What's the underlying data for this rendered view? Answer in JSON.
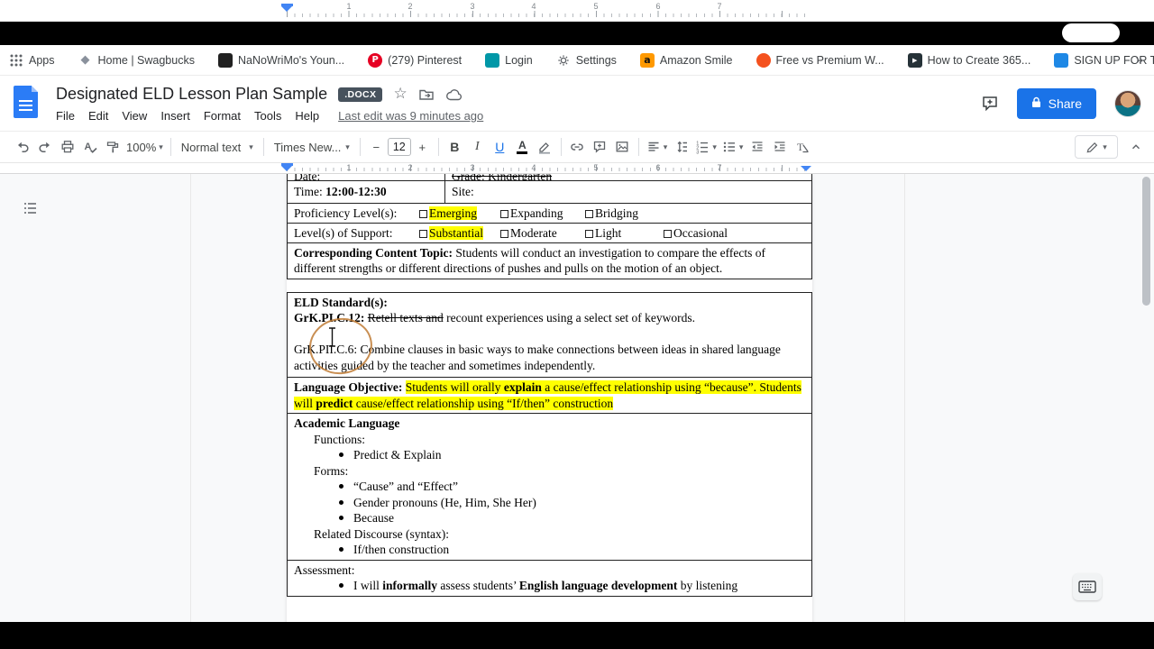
{
  "colors": {
    "accent_blue": "#1a73e8",
    "highlight_yellow": "#ffff00",
    "docx_badge_bg": "#47525d",
    "annotation_orange": "#bf7b35",
    "pinterest_red": "#e60023",
    "amazon_orange": "#ff9900"
  },
  "bookmarks_bar": {
    "apps_label": "Apps",
    "overflow_glyph": "»",
    "items": [
      {
        "label": "Home | Swagbucks",
        "icon": "swagbucks-favicon",
        "glyph": "◆"
      },
      {
        "label": "NaNoWriMo's Youn...",
        "icon": "nanowrimo-favicon",
        "glyph": ""
      },
      {
        "label": "(279) Pinterest",
        "icon": "pinterest-favicon",
        "glyph": "P"
      },
      {
        "label": "Login",
        "icon": "login-favicon",
        "glyph": ""
      },
      {
        "label": "Settings",
        "icon": "settings-gear-favicon",
        "glyph": ""
      },
      {
        "label": "Amazon Smile",
        "icon": "amazon-favicon",
        "glyph": "a"
      },
      {
        "label": "Free vs Premium W...",
        "icon": "generic-favicon",
        "glyph": ""
      },
      {
        "label": "How to Create 365...",
        "icon": "video-favicon",
        "glyph": "▶"
      },
      {
        "label": "SIGN UP FOR THE...",
        "icon": "generic-favicon",
        "glyph": ""
      }
    ]
  },
  "header": {
    "doc_title": "Designated ELD Lesson Plan Sample",
    "file_type_badge": ".DOCX",
    "menu_items": [
      "File",
      "Edit",
      "View",
      "Insert",
      "Format",
      "Tools",
      "Help"
    ],
    "last_edit_status": "Last edit was 9 minutes ago",
    "share_label": "Share"
  },
  "toolbar": {
    "zoom_value": "100%",
    "style_value": "Normal text",
    "font_value": "Times New...",
    "font_size_value": "12",
    "bold_glyph": "B",
    "italic_glyph": "I",
    "underline_glyph": "U",
    "text_color_glyph": "A",
    "minus_glyph": "−",
    "plus_glyph": "+",
    "caret_glyph": "▾"
  },
  "ruler": {
    "numbers": [
      "1",
      "2",
      "3",
      "4",
      "5",
      "6",
      "7"
    ]
  },
  "document": {
    "rowA": {
      "date_label": "Date:",
      "grade_struck": "Grade: Kindergarten"
    },
    "rowB": {
      "time_label": "Time: ",
      "time_value": "12:00-12:30",
      "site_label": "Site:"
    },
    "proficiency": {
      "label": "Proficiency Level(s):",
      "options": [
        {
          "text": "Emerging",
          "highlighted": true
        },
        {
          "text": "Expanding",
          "highlighted": false
        },
        {
          "text": "Bridging",
          "highlighted": false
        }
      ]
    },
    "support": {
      "label": "Level(s) of Support:",
      "options": [
        {
          "text": "Substantial",
          "highlighted": true
        },
        {
          "text": "Moderate",
          "highlighted": false
        },
        {
          "text": "Light",
          "highlighted": false
        },
        {
          "text": "Occasional",
          "highlighted": false
        }
      ]
    },
    "content_topic": {
      "label": "Corresponding Content Topic: ",
      "text": "Students will conduct an investigation to compare the effects of different strengths or different directions of pushes and pulls on the motion of an object."
    },
    "eld": {
      "heading": "ELD Standard(s):",
      "std1_code": "GrK.PI.C.12: ",
      "std1_struck": "Retell texts and",
      "std1_rest": " recount experiences using a select set of keywords.",
      "std2_code": "GrK.PII.C.6:",
      "std2_rest": " Combine clauses in basic ways to make connections between ideas in shared language activities guided by the teacher and sometimes independently."
    },
    "objective": {
      "label": "Language Objective: ",
      "hl_1": "Students will orally ",
      "hl_bold1": "explain",
      "hl_2": " a cause/effect relationship using “because”. Students will ",
      "hl_bold2": "predict",
      "hl_3": " cause/effect relationship using “If/then” construction"
    },
    "academic": {
      "heading": "Academic Language",
      "functions_label": "Functions:",
      "functions_items": [
        "Predict & Explain"
      ],
      "forms_label": "Forms:",
      "forms_items": [
        "“Cause” and “Effect”",
        "Gender pronouns (He, Him, She Her)",
        "Because"
      ],
      "discourse_label": "Related Discourse (syntax):",
      "discourse_items": [
        "If/then construction"
      ]
    },
    "assessment": {
      "label": "Assessment:",
      "item_1": "I will ",
      "item_bold1": "informally",
      "item_2": " assess students’ ",
      "item_bold2": "English language development",
      "item_3": " by listening"
    }
  }
}
